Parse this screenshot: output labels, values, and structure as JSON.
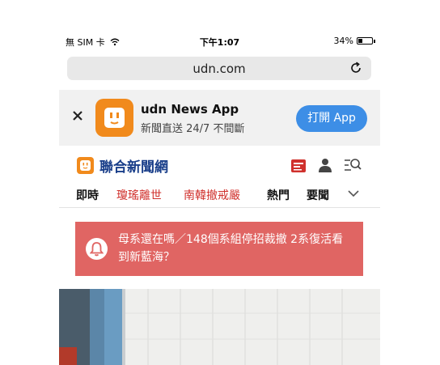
{
  "status_bar": {
    "carrier": "無 SIM 卡",
    "time": "下午1:07",
    "battery": "34%",
    "battery_level": 0.34
  },
  "browser": {
    "url": "udn.com"
  },
  "app_banner": {
    "title": "udn News App",
    "subtitle": "新聞直送 24/7 不間斷",
    "open_button": "打開 App"
  },
  "site": {
    "logo_text": "聯合新聞網"
  },
  "nav": {
    "tabs": [
      {
        "label": "即時"
      },
      {
        "label": "瓊瑤離世"
      },
      {
        "label": "南韓撤戒嚴"
      },
      {
        "label": "熱門"
      },
      {
        "label": "要聞"
      }
    ]
  },
  "alert": {
    "text": "母系還在嗎／148個系組停招裁撤 2系復活看到新藍海？"
  },
  "colors": {
    "brand_orange": "#f18a1c",
    "logo_blue": "#1a3f8a",
    "open_button": "#3d8ee6",
    "alert_red": "#e06563",
    "tab_red": "#d0312d"
  }
}
